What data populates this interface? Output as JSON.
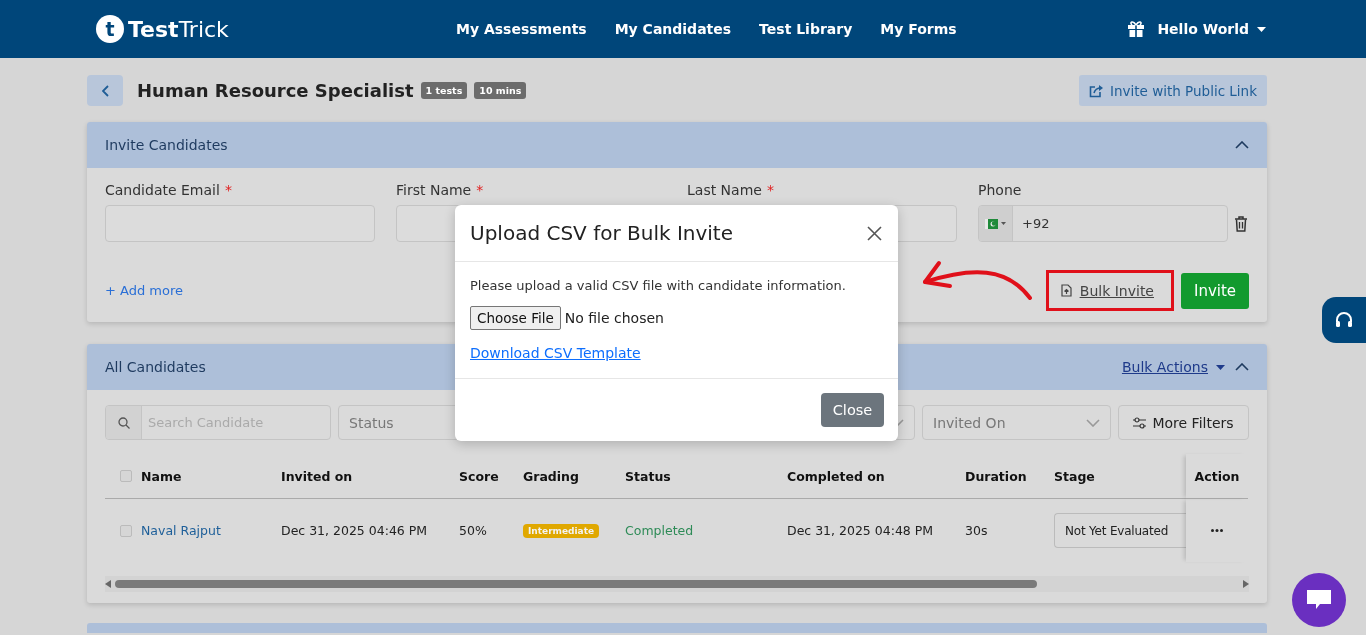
{
  "header": {
    "logo_mark": "t",
    "logo_bold": "Test",
    "logo_light": "Trick",
    "nav": [
      {
        "label": "My Assessments"
      },
      {
        "label": "My Candidates"
      },
      {
        "label": "Test Library"
      },
      {
        "label": "My Forms"
      }
    ],
    "user": "Hello World"
  },
  "page": {
    "title": "Human Resource Specialist",
    "badges": [
      "1 tests",
      "10 mins"
    ],
    "public_link": "Invite with Public Link"
  },
  "invite": {
    "title": "Invite Candidates",
    "expanded": true,
    "fields": [
      {
        "kind": "text",
        "label": "Candidate Email",
        "required": true
      },
      {
        "kind": "text",
        "label": "First Name",
        "required": true
      },
      {
        "kind": "text",
        "label": "Last Name",
        "required": true
      },
      {
        "kind": "phone",
        "label": "Phone",
        "required": false,
        "value": "+92"
      }
    ],
    "required_mark": "*",
    "add_more": "+ Add more",
    "bulk_invite": {
      "label": "Bulk Invite",
      "highlighted": true
    },
    "invite_button": "Invite"
  },
  "candidates": {
    "title": "All Candidates",
    "bulk_actions": "Bulk Actions",
    "expanded": true,
    "filters": [
      {
        "kind": "search",
        "placeholder": "Search Candidate"
      },
      {
        "kind": "select",
        "placeholder": "Status"
      },
      {
        "kind": "select"
      },
      {
        "kind": "select",
        "placeholder": "Invited On"
      },
      {
        "kind": "button",
        "label": "More Filters"
      }
    ],
    "all_checked": false,
    "columns": [
      "Name",
      "Invited on",
      "Score",
      "Grading",
      "Status",
      "Completed on",
      "Duration",
      "Stage",
      "Action"
    ],
    "rows": [
      {
        "checked": false,
        "name": "Naval Rajput",
        "invited_on": "Dec 31, 2025 04:46 PM",
        "score": "50%",
        "grading": "Intermediate",
        "status": "Completed",
        "completed_on": "Dec 31, 2025 04:48 PM",
        "duration": "30s",
        "stage": "Not Yet Evaluated"
      }
    ]
  },
  "modal": {
    "title": "Upload CSV for Bulk Invite",
    "message": "Please upload a valid CSV file with candidate information.",
    "file_button": "Choose File",
    "file_status": "No file chosen",
    "template_link": "Download CSV Template",
    "close_button": "Close"
  }
}
